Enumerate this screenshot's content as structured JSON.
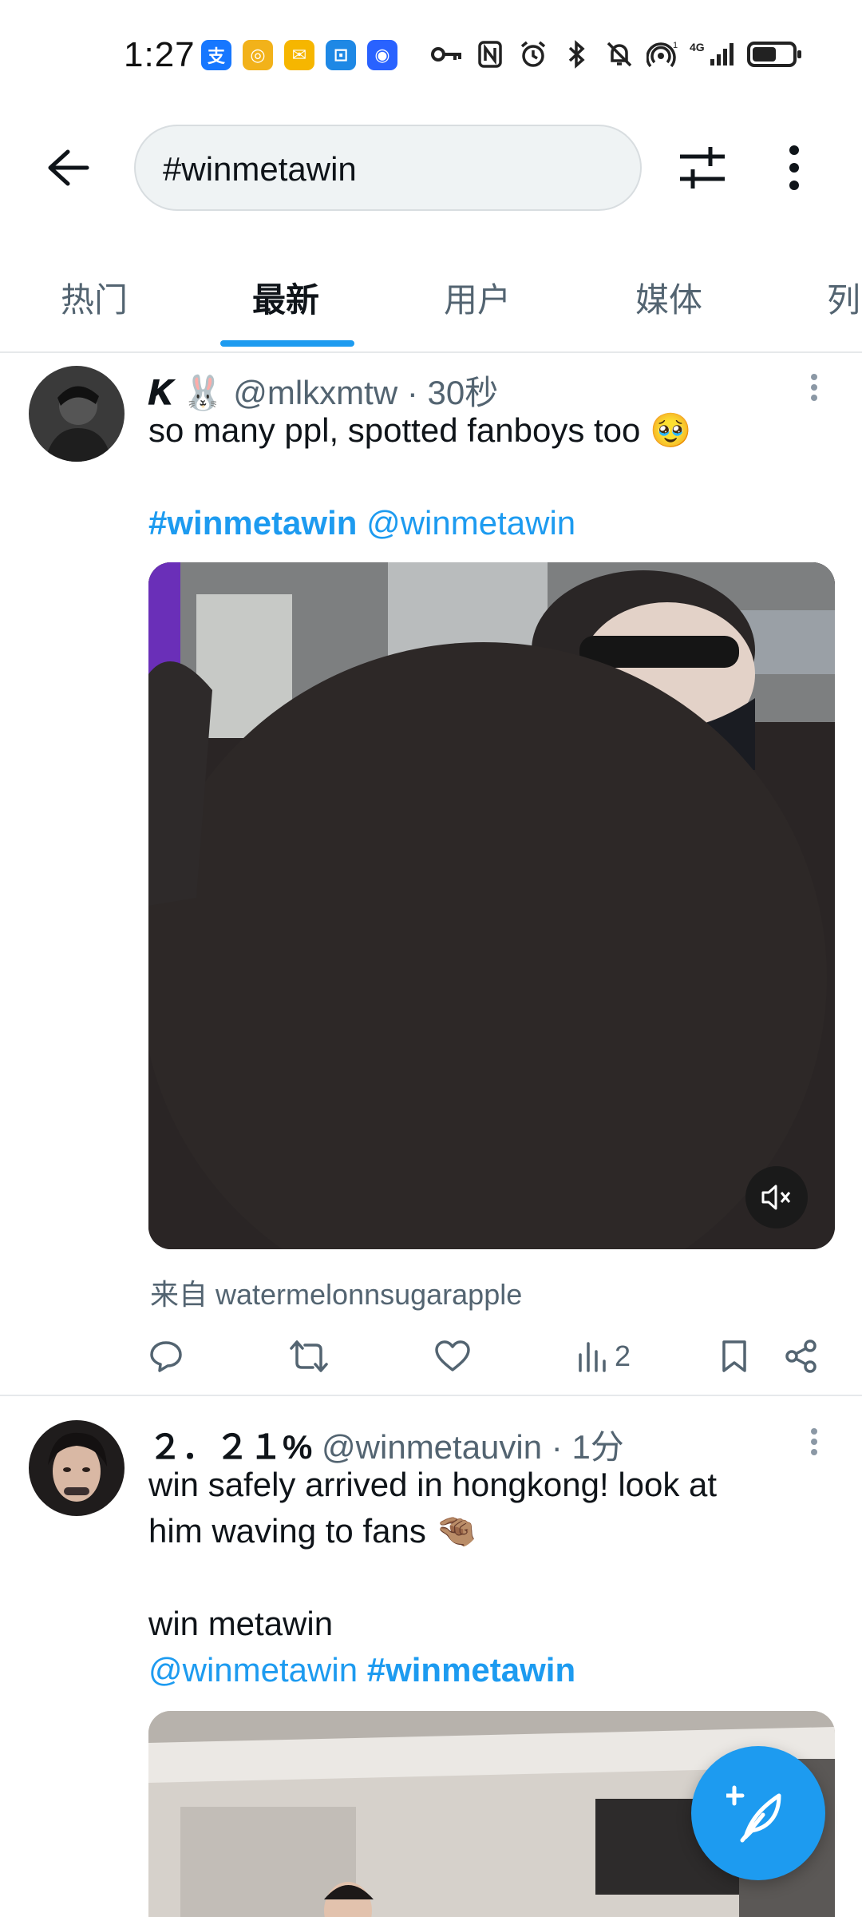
{
  "status_bar": {
    "time": "1:27",
    "network": "4G",
    "signal_sup": "1",
    "battery_level": 0.6,
    "apps": [
      {
        "icon": "alipay-icon",
        "glyph": "支",
        "color": "#1677ff"
      },
      {
        "icon": "game-app-icon",
        "glyph": "◎",
        "color": "#f2b21a"
      },
      {
        "icon": "mail-app-icon",
        "glyph": "✉",
        "color": "#f6b600"
      },
      {
        "icon": "shopping-bag-icon",
        "glyph": "⊡",
        "color": "#1e88e5"
      },
      {
        "icon": "shield-app-icon",
        "glyph": "◉",
        "color": "#2962ff"
      }
    ]
  },
  "search": {
    "query": "#winmetawin"
  },
  "tabs": [
    {
      "label": "热门",
      "active": false
    },
    {
      "label": "最新",
      "active": true
    },
    {
      "label": "用户",
      "active": false
    },
    {
      "label": "媒体",
      "active": false
    },
    {
      "label": "列",
      "active": false
    }
  ],
  "tweets": [
    {
      "display_name": "𝑲 🐰",
      "handle": "@mlkxmtw",
      "separator": "·",
      "time": "30秒",
      "text_line": "so many ppl, spotted fanboys too 🥹",
      "hashtag": "#winmetawin",
      "mention": "@winmetawin",
      "source": "来自 watermelonnsugarapple",
      "views": "2"
    },
    {
      "display_name": "２．２１%",
      "handle": "@winmetauvin",
      "separator": "·",
      "time": "1分",
      "text_line_1": "win safely arrived in hongkong! look at",
      "text_line_2": "him waving to fans 🤏🏽",
      "text_line_3": "win metawin",
      "mention": "@winmetawin",
      "hashtag": "#winmetawin"
    }
  ],
  "colors": {
    "accent": "#1d9bf0",
    "secondary_text": "#536471",
    "primary_text": "#0f1419"
  }
}
